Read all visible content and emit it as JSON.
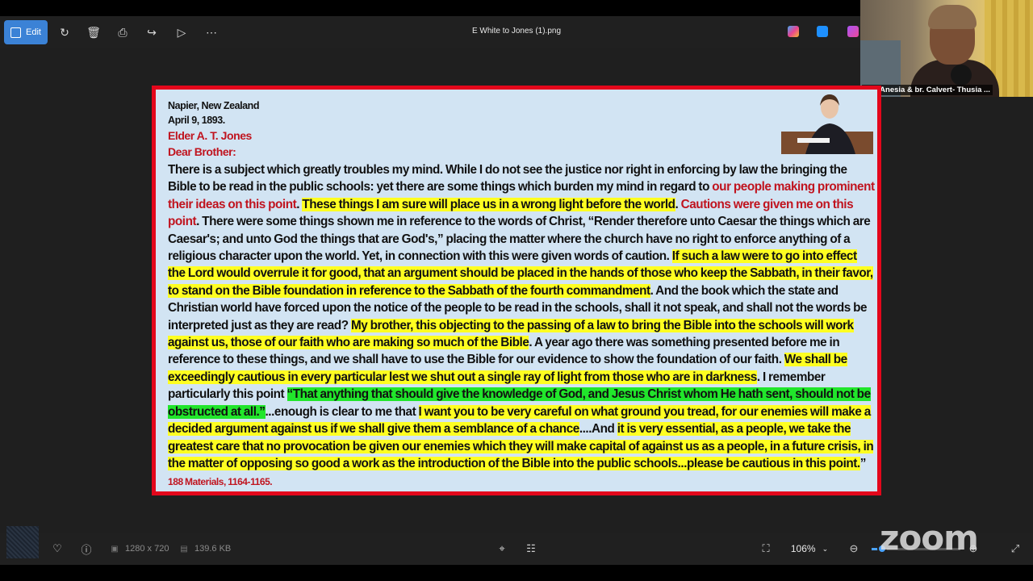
{
  "viewer": {
    "title": "E White to Jones (1).png",
    "edit_label": "Edit",
    "toolbar_icons": [
      "rotate-icon",
      "delete-icon",
      "print-icon",
      "share-icon",
      "slideshow-icon",
      "more-icon"
    ],
    "app_icons": [
      "copilot-icon",
      "clipchamp-icon",
      "designer-icon"
    ]
  },
  "video": {
    "participant_label": "Sis. Anesia & br. Calvert- Thusia ..."
  },
  "letter": {
    "place": "Napier, New Zealand",
    "date": "April 9, 1893.",
    "recipient": "Elder A. T. Jones",
    "salutation": "Dear Brother:",
    "runs": [
      {
        "t": "There is a subject which greatly troubles my mind. While I do not see the justice nor right in enforcing by law the bringing the Bible to be read in the public schools: yet there are some things which burden my mind in regard to ",
        "s": ""
      },
      {
        "t": "our people making prominent their ideas on this point",
        "s": "red"
      },
      {
        "t": ". ",
        "s": ""
      },
      {
        "t": "These things I am sure will place us in a wrong light before the world",
        "s": "yellow"
      },
      {
        "t": ". ",
        "s": ""
      },
      {
        "t": "Cautions were given me on this point",
        "s": "red"
      },
      {
        "t": ". There were some things shown me in reference to the words of Christ, “Render therefore unto Caesar the things which are Caesar's; and unto God the things that are God's,” placing the matter where the church have no right to enforce anything of a religious character upon the world. Yet, in connection with this were given words of caution. ",
        "s": ""
      },
      {
        "t": "If such a law were to go into effect the Lord would overrule it for good, that an argument should be placed in the hands of those who keep the Sabbath, in their favor, to stand on the Bible foundation in reference to the Sabbath of the fourth commandment",
        "s": "yellow"
      },
      {
        "t": ". And the book which the state and Christian world have forced upon the notice of the people to be read in the schools, shall it not speak, and shall not the words be interpreted just as they are read? ",
        "s": ""
      },
      {
        "t": "My brother, this objecting to the passing of a law to bring the Bible into the schools will work against us, those of our faith who are making so much of the Bible",
        "s": "yellow"
      },
      {
        "t": ". A year ago there was something presented before me in reference to these things, and we shall have to use the Bible for our evidence to show the foundation of our faith. ",
        "s": ""
      },
      {
        "t": "We shall be exceedingly cautious in every particular lest we shut out a single ray of light from those who are in darkness",
        "s": "yellow"
      },
      {
        "t": ". I remember particularly this point ",
        "s": ""
      },
      {
        "t": "“That anything that should give the knowledge of God, and Jesus Christ whom He hath sent, should not be obstructed at all.”",
        "s": "green"
      },
      {
        "t": "...enough is clear to me that ",
        "s": ""
      },
      {
        "t": "I want you to be very careful on what ground you tread, for our enemies will make a decided argument against us if we shall give them a semblance of a chance",
        "s": "yellow"
      },
      {
        "t": "....And ",
        "s": ""
      },
      {
        "t": "it is very essential, as a people, we take the greatest care that no provocation be given our enemies which they will make capital of against us as a people, in a future crisis, in the matter of opposing so good a work as the introduction of the Bible into the public schools...please be cautious in this point.",
        "s": "yellow"
      },
      {
        "t": "”",
        "s": ""
      }
    ],
    "reference": " 188 Materials, 1164-1165."
  },
  "bottombar": {
    "dimensions": "1280 x 720",
    "filesize": "139.6 KB",
    "zoom_level": "106%",
    "zoom_fraction": 0.12
  },
  "watermark": "zoom",
  "colors": {
    "frame_border": "#e3061b",
    "paper": "#d2e4f3",
    "highlight_yellow": "#ffff21",
    "highlight_green": "#21e62b",
    "text_red": "#c0141f",
    "accent": "#3b82d6"
  }
}
